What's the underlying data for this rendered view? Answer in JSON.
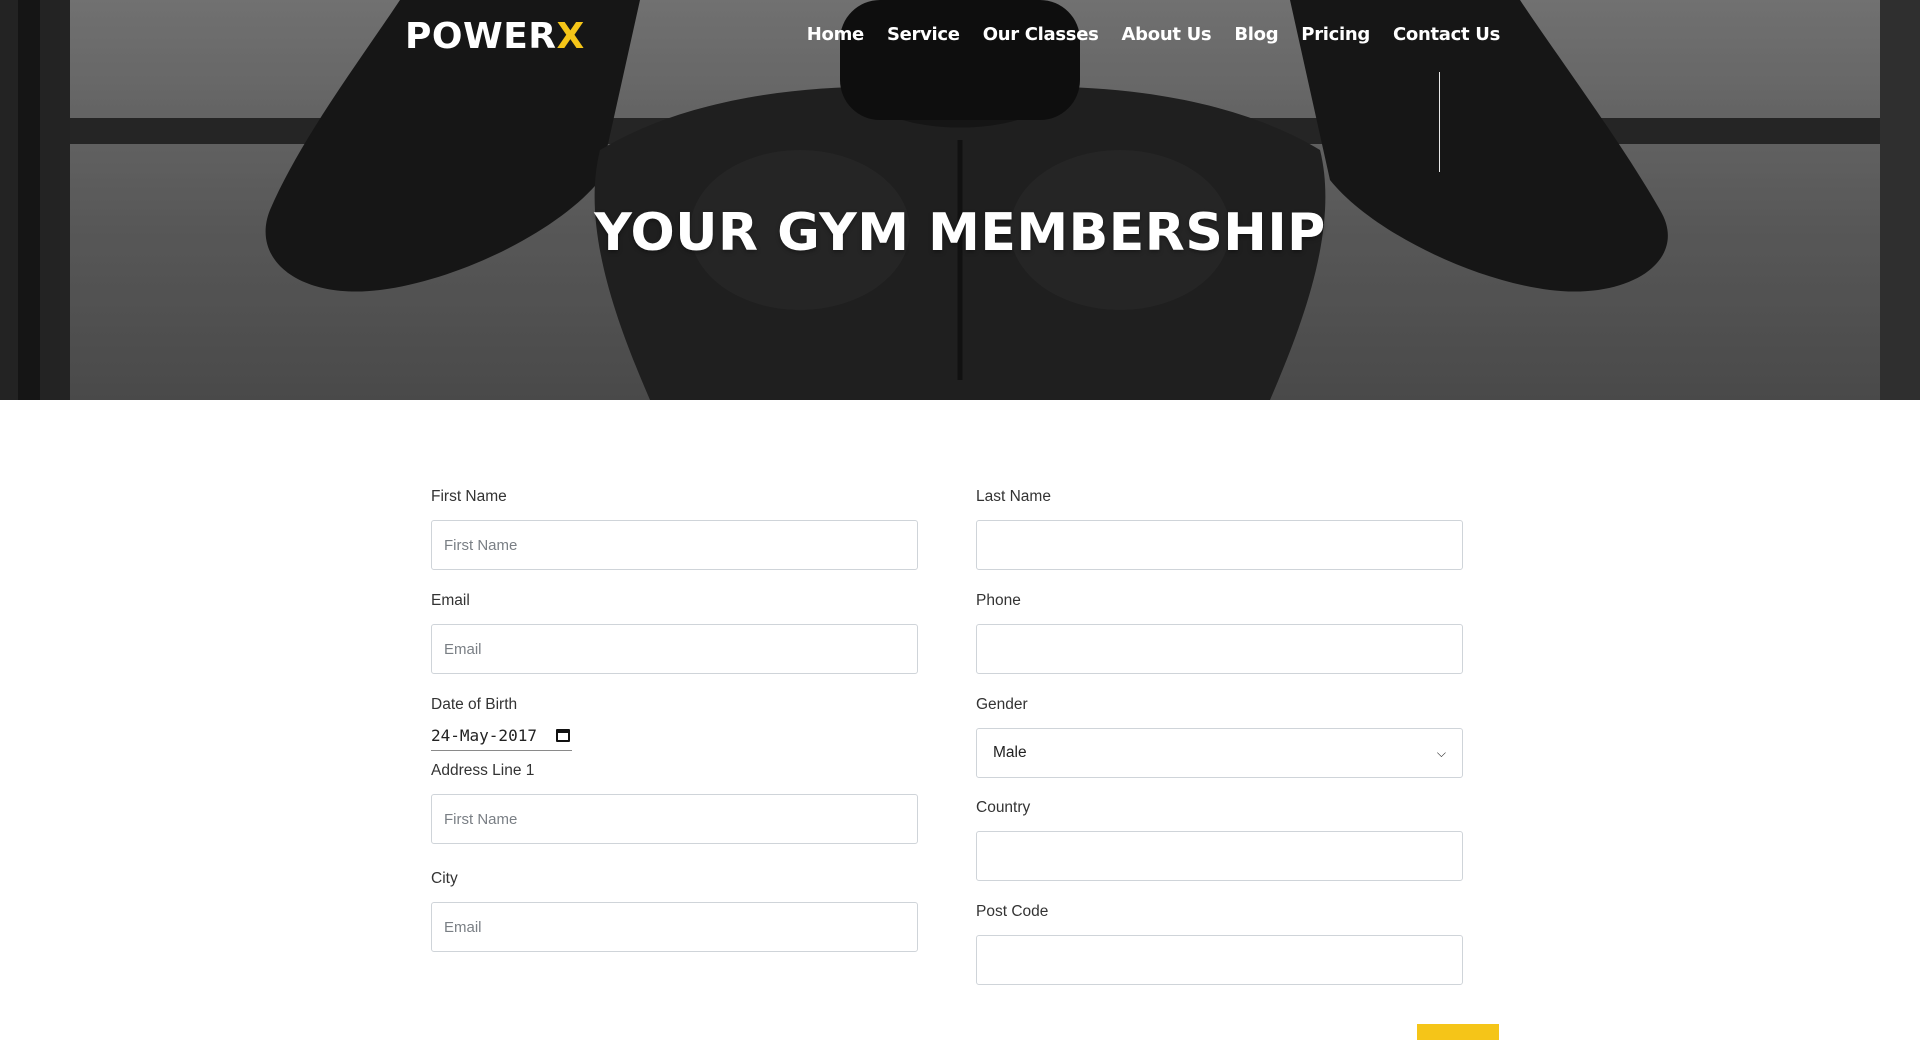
{
  "brand": {
    "name_main": "POWER",
    "name_accent": "X",
    "accent_color": "#f5c518"
  },
  "nav": {
    "items": [
      "Home",
      "Service",
      "Our Classes",
      "About Us",
      "Blog",
      "Pricing",
      "Contact Us"
    ]
  },
  "hero": {
    "title": "YOUR GYM MEMBERSHIP"
  },
  "form": {
    "first_name": {
      "label": "First Name",
      "placeholder": "First Name",
      "value": ""
    },
    "last_name": {
      "label": "Last Name",
      "placeholder": "",
      "value": ""
    },
    "email": {
      "label": "Email",
      "placeholder": "Email",
      "value": ""
    },
    "phone": {
      "label": "Phone",
      "placeholder": "",
      "value": ""
    },
    "dob": {
      "label": "Date of Birth",
      "value": "24-May-2017",
      "icon": "calendar-icon"
    },
    "gender": {
      "label": "Gender",
      "value": "Male",
      "icon": "chevron-down-icon"
    },
    "address1": {
      "label": "Address Line 1",
      "placeholder": "First Name",
      "value": ""
    },
    "country": {
      "label": "Country",
      "placeholder": "",
      "value": ""
    },
    "city": {
      "label": "City",
      "placeholder": "Email",
      "value": ""
    },
    "post_code": {
      "label": "Post Code",
      "placeholder": "",
      "value": ""
    }
  }
}
